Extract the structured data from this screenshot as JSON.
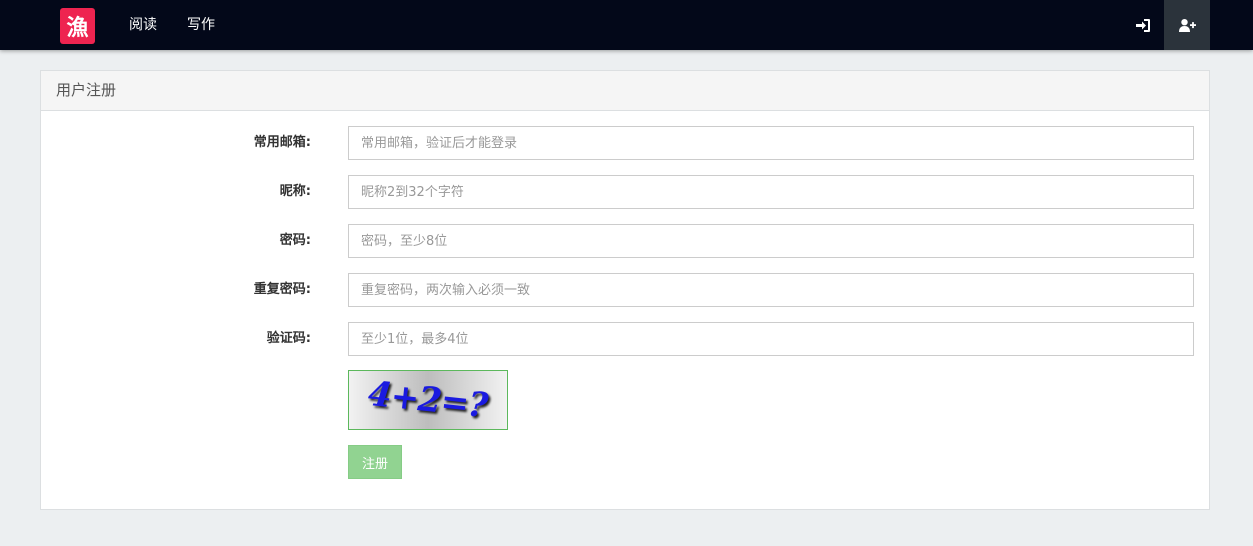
{
  "navbar": {
    "logo_text": "漁",
    "links": [
      {
        "label": "阅读"
      },
      {
        "label": "写作"
      }
    ]
  },
  "panel": {
    "title": "用户注册"
  },
  "form": {
    "fields": [
      {
        "label": "常用邮箱:",
        "placeholder": "常用邮箱，验证后才能登录",
        "value": ""
      },
      {
        "label": "昵称:",
        "placeholder": "昵称2到32个字符",
        "value": ""
      },
      {
        "label": "密码:",
        "placeholder": "密码，至少8位",
        "value": ""
      },
      {
        "label": "重复密码:",
        "placeholder": "重复密码，两次输入必须一致",
        "value": ""
      },
      {
        "label": "验证码:",
        "placeholder": "至少1位，最多4位",
        "value": ""
      }
    ],
    "captcha_text": "4+2=?",
    "submit_label": "注册"
  },
  "colors": {
    "navbar_bg": "#030819",
    "logo_bg": "#ee2450",
    "register_icon_bg": "#2b333b",
    "submit_bg": "#91d391",
    "page_bg": "#eceff1"
  },
  "icons": {
    "login": "sign-in-icon",
    "register": "user-plus-icon"
  }
}
